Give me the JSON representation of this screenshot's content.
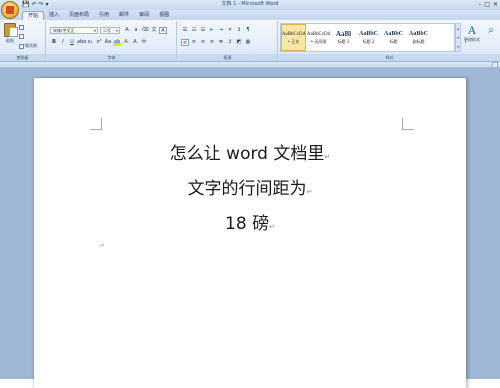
{
  "window": {
    "title": "文档 1 - Microsoft Word",
    "quick_access": [
      "💾",
      "↶",
      "↷",
      "▾"
    ],
    "controls": [
      "–",
      "□",
      "✕"
    ]
  },
  "tabs": [
    {
      "label": "开始",
      "active": true
    },
    {
      "label": "插入",
      "active": false
    },
    {
      "label": "页面布局",
      "active": false
    },
    {
      "label": "引用",
      "active": false
    },
    {
      "label": "邮件",
      "active": false
    },
    {
      "label": "审阅",
      "active": false
    },
    {
      "label": "视图",
      "active": false
    }
  ],
  "ribbon": {
    "clipboard": {
      "paste_label": "粘贴",
      "format_painter_label": "格式刷",
      "group_label": "剪贴板"
    },
    "font": {
      "font_name": "宋体(中文正",
      "font_size": "二号",
      "group_label": "字体"
    },
    "paragraph": {
      "group_label": "段落"
    },
    "styles": {
      "tiles": [
        {
          "sample": "AaBbCcDd",
          "name": "• 正文",
          "selected": true
        },
        {
          "sample": "AaBbCcDd",
          "name": "• 无间隔",
          "selected": false
        },
        {
          "sample": "AaBl",
          "name": "标题 1",
          "selected": false
        },
        {
          "sample": "AaBbC",
          "name": "标题 2",
          "selected": false
        },
        {
          "sample": "AaBbC",
          "name": "标题",
          "selected": false
        },
        {
          "sample": "AaBbC",
          "name": "副标题",
          "selected": false
        }
      ],
      "change_styles_label": "更改样式",
      "group_label": "样式"
    }
  },
  "document": {
    "lines": [
      "怎么让 word 文档里",
      "文字的行间距为",
      "18 磅"
    ],
    "paragraph_mark": "↵"
  }
}
